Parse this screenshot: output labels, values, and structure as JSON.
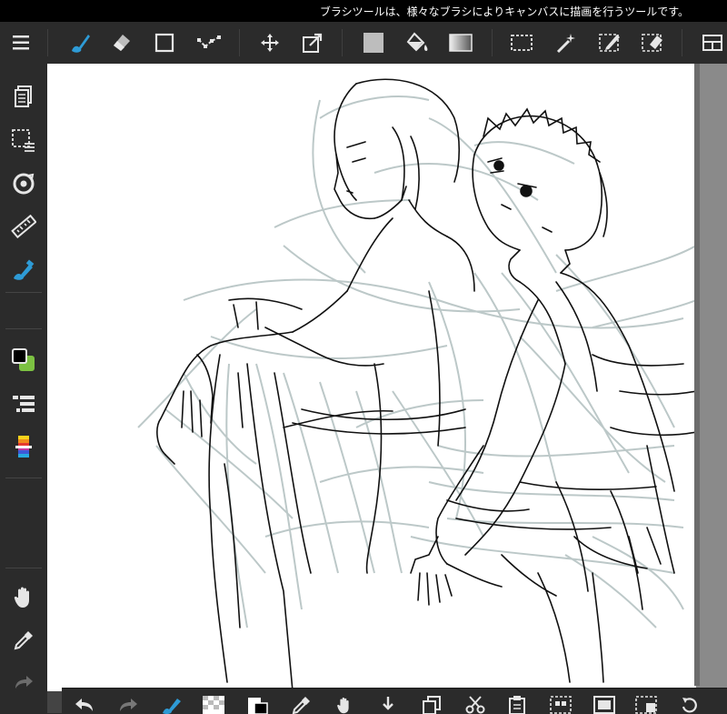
{
  "status_bar": {
    "message": "ブラシツールは、様々なブラシによりキャンバスに描画を行うツールです。"
  },
  "top_toolbar": {
    "icons": [
      "menu-icon",
      "brush-icon",
      "eraser-icon",
      "shape-icon",
      "curve-icon",
      "move-icon",
      "transform-icon",
      "fill-color-icon",
      "bucket-icon",
      "gradient-icon",
      "select-rect-icon",
      "magic-wand-icon",
      "select-pen-icon",
      "select-eraser-icon",
      "layout-icon"
    ],
    "active_tool": "brush-icon"
  },
  "left_sidebar": {
    "icons": [
      "layers-icon",
      "selection-icon",
      "snap-icon",
      "ruler-icon",
      "brush-settings-icon",
      "color-swatch-icon",
      "layer-list-icon",
      "color-palette-icon",
      "hand-icon",
      "eyedropper-icon",
      "redo-icon"
    ],
    "foreground_color": "#000000",
    "background_color": "#7cc142"
  },
  "bottom_toolbar": {
    "icons": [
      "undo-icon",
      "redo-icon",
      "brush-quick-icon",
      "transparent-icon",
      "color-layer-icon",
      "eyedropper-quick-icon",
      "hand-quick-icon",
      "merge-down-icon",
      "copy-icon",
      "cut-icon",
      "paste-icon",
      "select-all-icon",
      "deselect-icon",
      "invert-select-icon",
      "rotate-icon"
    ]
  },
  "canvas": {
    "description_free": true,
    "paper_color": "#ffffff",
    "sketch_color": "#b9c6c6",
    "line_color": "#111111"
  },
  "colors": {
    "toolbar_bg": "#2b2b2b",
    "accent_blue": "#2e9bd6",
    "icon_gray": "#cfcfcf"
  }
}
